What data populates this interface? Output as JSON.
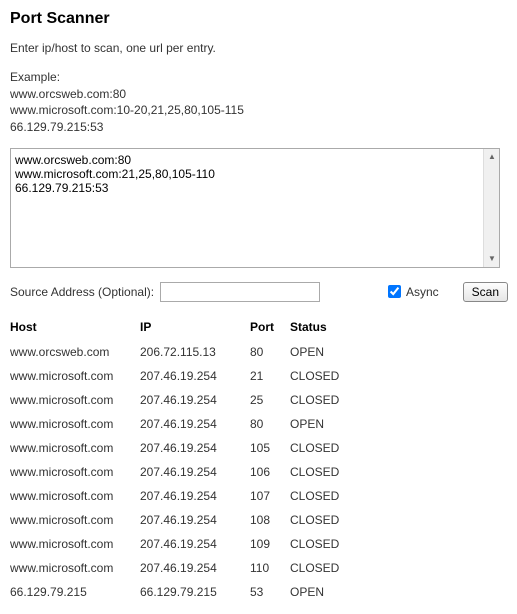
{
  "title": "Port Scanner",
  "instructions": "Enter ip/host to scan, one url per entry.",
  "example_label": "Example:",
  "example_lines": [
    "www.orcsweb.com:80",
    "www.microsoft.com:10-20,21,25,80,105-115",
    "66.129.79.215:53"
  ],
  "input_value": "www.orcsweb.com:80\nwww.microsoft.com:21,25,80,105-110\n66.129.79.215:53",
  "source_label": "Source Address (Optional):",
  "source_value": "",
  "async_label": "Async",
  "async_checked": true,
  "scan_label": "Scan",
  "headers": {
    "host": "Host",
    "ip": "IP",
    "port": "Port",
    "status": "Status"
  },
  "results": [
    {
      "host": "www.orcsweb.com",
      "ip": "206.72.115.13",
      "port": "80",
      "status": "OPEN"
    },
    {
      "host": "www.microsoft.com",
      "ip": "207.46.19.254",
      "port": "21",
      "status": "CLOSED"
    },
    {
      "host": "www.microsoft.com",
      "ip": "207.46.19.254",
      "port": "25",
      "status": "CLOSED"
    },
    {
      "host": "www.microsoft.com",
      "ip": "207.46.19.254",
      "port": "80",
      "status": "OPEN"
    },
    {
      "host": "www.microsoft.com",
      "ip": "207.46.19.254",
      "port": "105",
      "status": "CLOSED"
    },
    {
      "host": "www.microsoft.com",
      "ip": "207.46.19.254",
      "port": "106",
      "status": "CLOSED"
    },
    {
      "host": "www.microsoft.com",
      "ip": "207.46.19.254",
      "port": "107",
      "status": "CLOSED"
    },
    {
      "host": "www.microsoft.com",
      "ip": "207.46.19.254",
      "port": "108",
      "status": "CLOSED"
    },
    {
      "host": "www.microsoft.com",
      "ip": "207.46.19.254",
      "port": "109",
      "status": "CLOSED"
    },
    {
      "host": "www.microsoft.com",
      "ip": "207.46.19.254",
      "port": "110",
      "status": "CLOSED"
    },
    {
      "host": "66.129.79.215",
      "ip": "66.129.79.215",
      "port": "53",
      "status": "OPEN"
    }
  ]
}
